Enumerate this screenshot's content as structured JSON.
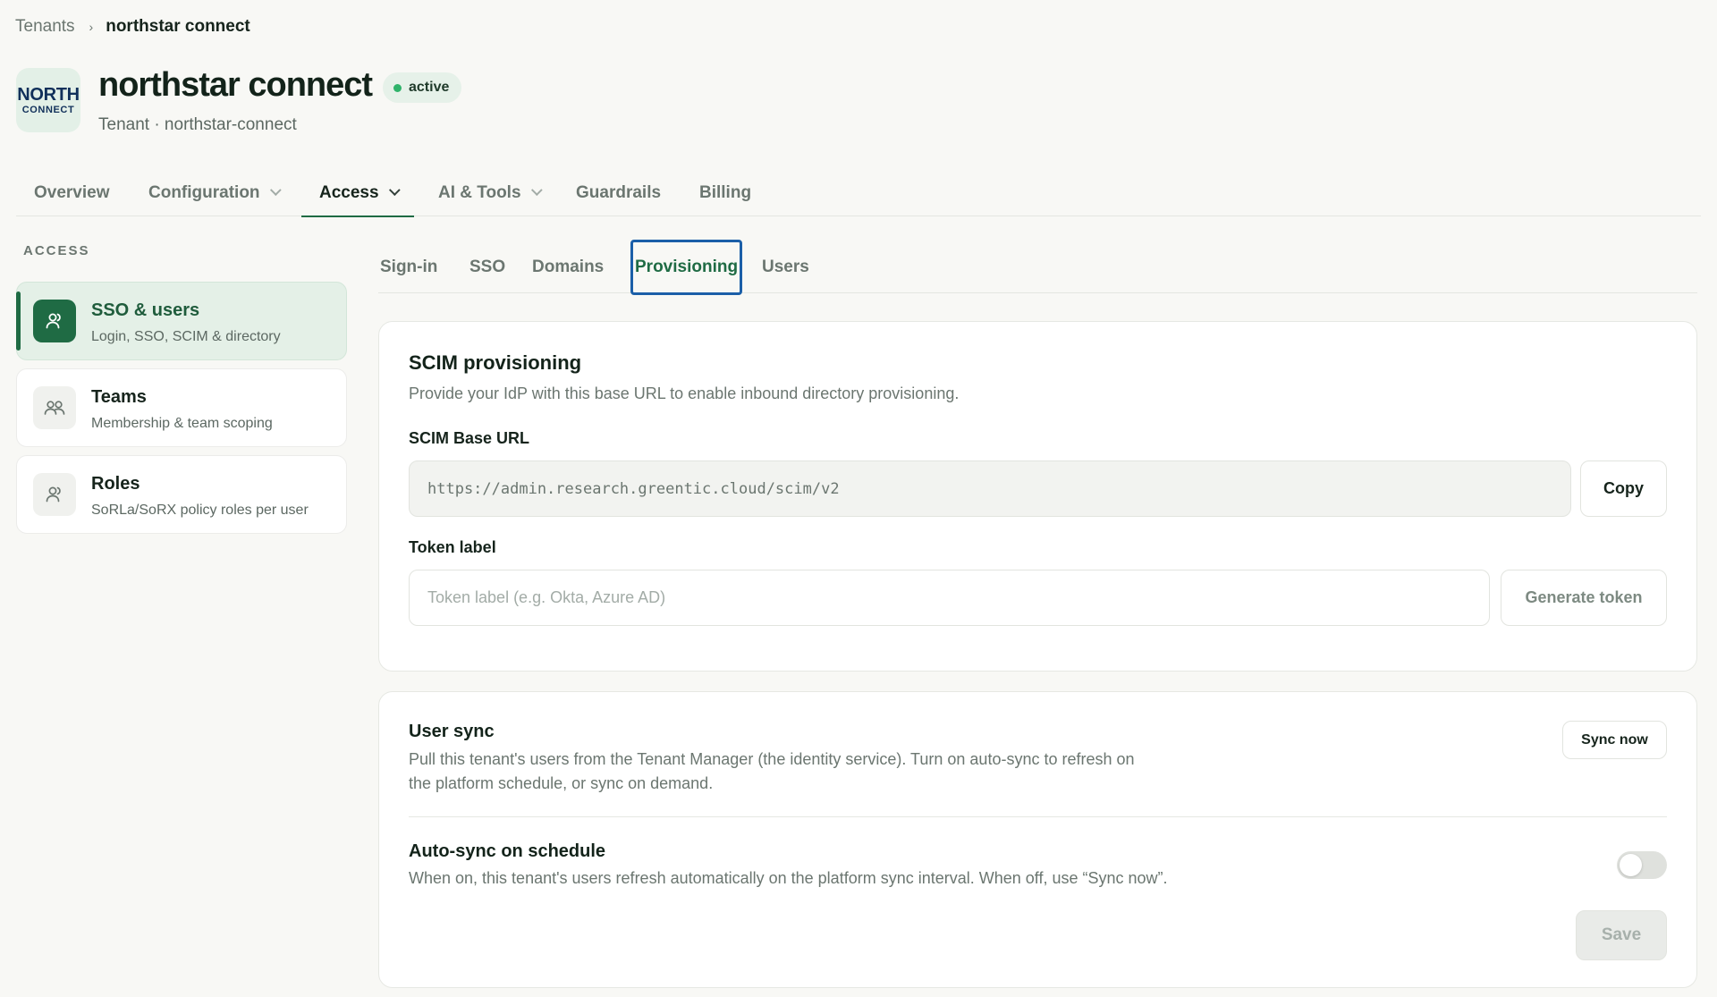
{
  "breadcrumb": {
    "root": "Tenants",
    "separator": "›",
    "current": "northstar connect"
  },
  "tenant": {
    "logo_line1": "NORTH",
    "logo_line2": "CONNECT",
    "name": "northstar connect",
    "status": "active",
    "subtitle": "Tenant · northstar-connect"
  },
  "main_tabs": [
    {
      "label": "Overview",
      "has_dropdown": false,
      "active": false
    },
    {
      "label": "Configuration",
      "has_dropdown": true,
      "active": false
    },
    {
      "label": "Access",
      "has_dropdown": true,
      "active": true
    },
    {
      "label": "AI & Tools",
      "has_dropdown": true,
      "active": false
    },
    {
      "label": "Guardrails",
      "has_dropdown": false,
      "active": false
    },
    {
      "label": "Billing",
      "has_dropdown": false,
      "active": false
    }
  ],
  "sidebar": {
    "header": "ACCESS",
    "items": [
      {
        "title": "SSO & users",
        "description": "Login, SSO, SCIM & directory",
        "icon": "user-icon",
        "active": true
      },
      {
        "title": "Teams",
        "description": "Membership & team scoping",
        "icon": "users-icon",
        "active": false
      },
      {
        "title": "Roles",
        "description": "SoRLa/SoRX policy roles per user",
        "icon": "user-icon",
        "active": false
      }
    ]
  },
  "sub_tabs": [
    {
      "label": "Sign-in",
      "active": false
    },
    {
      "label": "SSO",
      "active": false
    },
    {
      "label": "Domains",
      "active": false
    },
    {
      "label": "Provisioning",
      "active": true
    },
    {
      "label": "Users",
      "active": false
    }
  ],
  "scim": {
    "title": "SCIM provisioning",
    "description": "Provide your IdP with this base URL to enable inbound directory provisioning.",
    "base_url_label": "SCIM Base URL",
    "base_url_value": "https://admin.research.greentic.cloud/scim/v2",
    "copy_label": "Copy",
    "token_label": "Token label",
    "token_placeholder": "Token label (e.g. Okta, Azure AD)",
    "generate_label": "Generate token"
  },
  "user_sync": {
    "title": "User sync",
    "description_line1": "Pull this tenant's users from the Tenant Manager (the identity service). Turn on auto-sync to refresh on",
    "description_line2": "the platform schedule, or sync on demand.",
    "sync_now_label": "Sync now",
    "auto_sync_title": "Auto-sync on schedule",
    "auto_sync_description": "When on, this tenant's users refresh automatically on the platform sync interval. When off, use “Sync now”.",
    "auto_sync_enabled": false,
    "save_label": "Save"
  },
  "colors": {
    "accent": "#1f6b44",
    "status_dot": "#2fb36a",
    "focus_ring": "#1b5fa8"
  }
}
